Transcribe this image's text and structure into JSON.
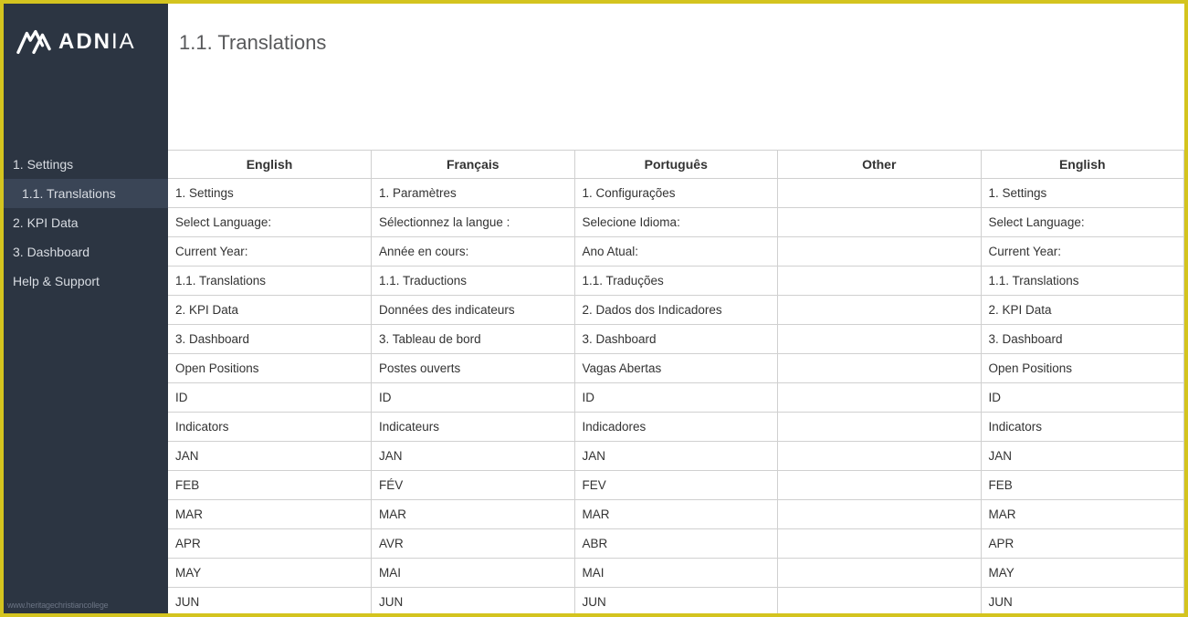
{
  "logo": {
    "text_bold": "ADN",
    "text_light": "IA"
  },
  "sidebar": {
    "items": [
      {
        "label": "1. Settings",
        "active": false,
        "sub": false
      },
      {
        "label": "1.1. Translations",
        "active": true,
        "sub": true
      },
      {
        "label": "2. KPI Data",
        "active": false,
        "sub": false
      },
      {
        "label": "3. Dashboard",
        "active": false,
        "sub": false
      },
      {
        "label": "Help & Support",
        "active": false,
        "sub": false
      }
    ],
    "watermark": "www.heritagechristiancollege"
  },
  "page": {
    "title": "1.1. Translations"
  },
  "table": {
    "headers": [
      "English",
      "Français",
      "Português",
      "Other",
      "English"
    ],
    "rows": [
      [
        "1. Settings",
        "1. Paramètres",
        "1. Configurações",
        "",
        "1. Settings"
      ],
      [
        "Select Language:",
        "Sélectionnez la langue :",
        "Selecione Idioma:",
        "",
        "Select Language:"
      ],
      [
        "Current Year:",
        "Année en cours:",
        "Ano Atual:",
        "",
        "Current Year:"
      ],
      [
        "1.1. Translations",
        "1.1. Traductions",
        "1.1. Traduções",
        "",
        "1.1. Translations"
      ],
      [
        "2. KPI Data",
        "Données des indicateurs",
        "2. Dados dos Indicadores",
        "",
        "2. KPI Data"
      ],
      [
        "3. Dashboard",
        "3. Tableau de bord",
        "3. Dashboard",
        "",
        "3. Dashboard"
      ],
      [
        "Open Positions",
        "Postes ouverts",
        "Vagas Abertas",
        "",
        "Open Positions"
      ],
      [
        "ID",
        "ID",
        "ID",
        "",
        "ID"
      ],
      [
        "Indicators",
        "Indicateurs",
        "Indicadores",
        "",
        "Indicators"
      ],
      [
        "JAN",
        "JAN",
        "JAN",
        "",
        "JAN"
      ],
      [
        "FEB",
        "FÉV",
        "FEV",
        "",
        "FEB"
      ],
      [
        "MAR",
        "MAR",
        "MAR",
        "",
        "MAR"
      ],
      [
        "APR",
        "AVR",
        "ABR",
        "",
        "APR"
      ],
      [
        "MAY",
        "MAI",
        "MAI",
        "",
        "MAY"
      ],
      [
        "JUN",
        "JUN",
        "JUN",
        "",
        "JUN"
      ]
    ]
  }
}
